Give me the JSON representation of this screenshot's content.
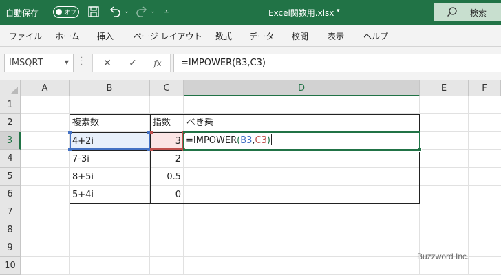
{
  "title_bar": {
    "autosave_label": "自動保存",
    "autosave_toggle": "オフ",
    "filename": "Excel関数用.xlsx",
    "search_label": "検索"
  },
  "ribbon_tabs": [
    "ファイル",
    "ホーム",
    "挿入",
    "ページ レイアウト",
    "数式",
    "データ",
    "校閲",
    "表示",
    "ヘルプ"
  ],
  "formula_bar": {
    "name_box": "IMSQRT",
    "fx_label": "fx",
    "formula": "=IMPOWER(B3,C3)"
  },
  "columns": [
    "A",
    "B",
    "C",
    "D",
    "E",
    "F"
  ],
  "rows": [
    "1",
    "2",
    "3",
    "4",
    "5",
    "6",
    "7",
    "8",
    "9",
    "10"
  ],
  "table": {
    "headers": [
      "複素数",
      "指数",
      "べき乗"
    ],
    "rows": [
      {
        "complex": "4+2i",
        "exponent": "3"
      },
      {
        "complex": "7-3i",
        "exponent": "2"
      },
      {
        "complex": "8+5i",
        "exponent": "0.5"
      },
      {
        "complex": "5+4i",
        "exponent": "0"
      }
    ]
  },
  "edit_cell": {
    "prefix": "=IMPOWER",
    "open_paren": "(",
    "ref_b": "B3",
    "comma": ",",
    "ref_c": "C3",
    "close_paren": ")"
  },
  "colors": {
    "title_bar": "#217346",
    "ref_b": "#4472c4",
    "ref_c": "#c0504d"
  },
  "watermark": "Buzzword Inc."
}
